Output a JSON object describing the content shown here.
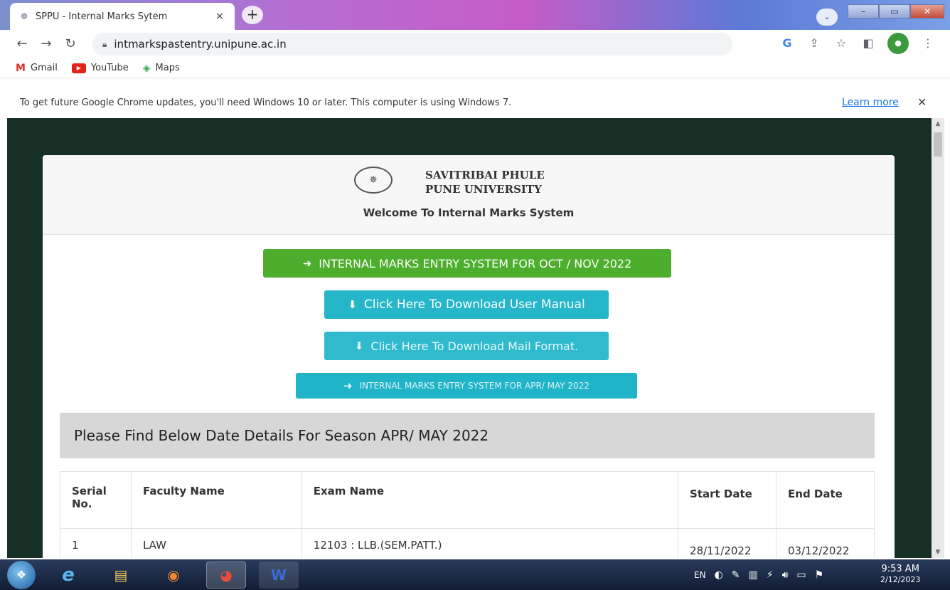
{
  "browser": {
    "tab_title": "SPPU - Internal Marks Sytem",
    "tab_close": "×",
    "new_tab": "+",
    "url": "intmarkspastentry.unipune.ac.in",
    "bookmarks": [
      {
        "label": "Gmail"
      },
      {
        "label": "YouTube"
      },
      {
        "label": "Maps"
      }
    ],
    "infobar": {
      "message": "To get future Google Chrome updates, you'll need Windows 10 or later. This computer is using Windows 7.",
      "learn_more": "Learn more",
      "close": "✕"
    }
  },
  "page": {
    "university_line1": "SAVITRIBAI PHULE",
    "university_line2": "PUNE UNIVERSITY",
    "welcome": "Welcome To Internal Marks System",
    "buttons": {
      "entry_oct_nov": "INTERNAL MARKS ENTRY SYSTEM FOR OCT / NOV 2022",
      "download_manual": "Click Here To Download User Manual",
      "download_mail": "Click Here To Download Mail Format.",
      "entry_apr_may": "INTERNAL MARKS ENTRY SYSTEM FOR APR/ MAY 2022"
    },
    "season_heading": "Please Find Below Date Details For Season APR/ MAY 2022",
    "table": {
      "headers": [
        "Serial No.",
        "Faculty Name",
        "Exam Name",
        "Start Date",
        "End Date"
      ],
      "rows": [
        {
          "serial": "1",
          "faculty": "LAW",
          "exam": "12103 : LLB.(SEM.PATT.)",
          "start": "28/11/2022",
          "end": "03/12/2022"
        }
      ]
    }
  },
  "taskbar": {
    "language": "EN",
    "time": "9:53 AM",
    "date": "2/12/2023"
  },
  "colors": {
    "green_button": "#4cae2c",
    "teal_button": "#26b6ca",
    "page_background": "#163026",
    "link": "#1a73e8"
  }
}
